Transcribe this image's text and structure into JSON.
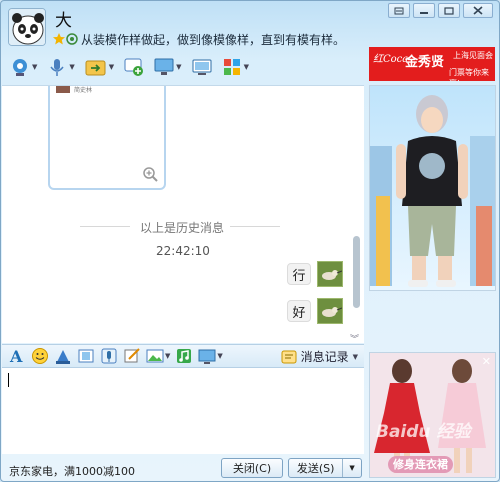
{
  "header": {
    "title": "大",
    "signature": "从装模作样做起，做到像模像样，直到有模有样。"
  },
  "chat": {
    "card_thumb_text": "简史林",
    "history_divider": "以上是历史消息",
    "timestamp": "22:42:10",
    "messages": [
      {
        "text": "行"
      },
      {
        "text": "好"
      }
    ]
  },
  "ads": {
    "top_brand": "红Coca",
    "top_title": "金秀贤",
    "top_sub": "上海见面会",
    "top_line2": "门票等你来赢!",
    "bottom_watermark": "Baidu 经验",
    "bottom_caption": "修身连衣裙"
  },
  "input_toolbar": {
    "history_label": "消息记录"
  },
  "footer": {
    "promo_text": "京东家电，满1000减100",
    "close_label": "关闭(C)",
    "send_label": "发送(S)"
  },
  "colors": {
    "accent": "#1e6fb6",
    "ad_red": "#e31d1d",
    "caption_pink": "#e39ab6"
  }
}
